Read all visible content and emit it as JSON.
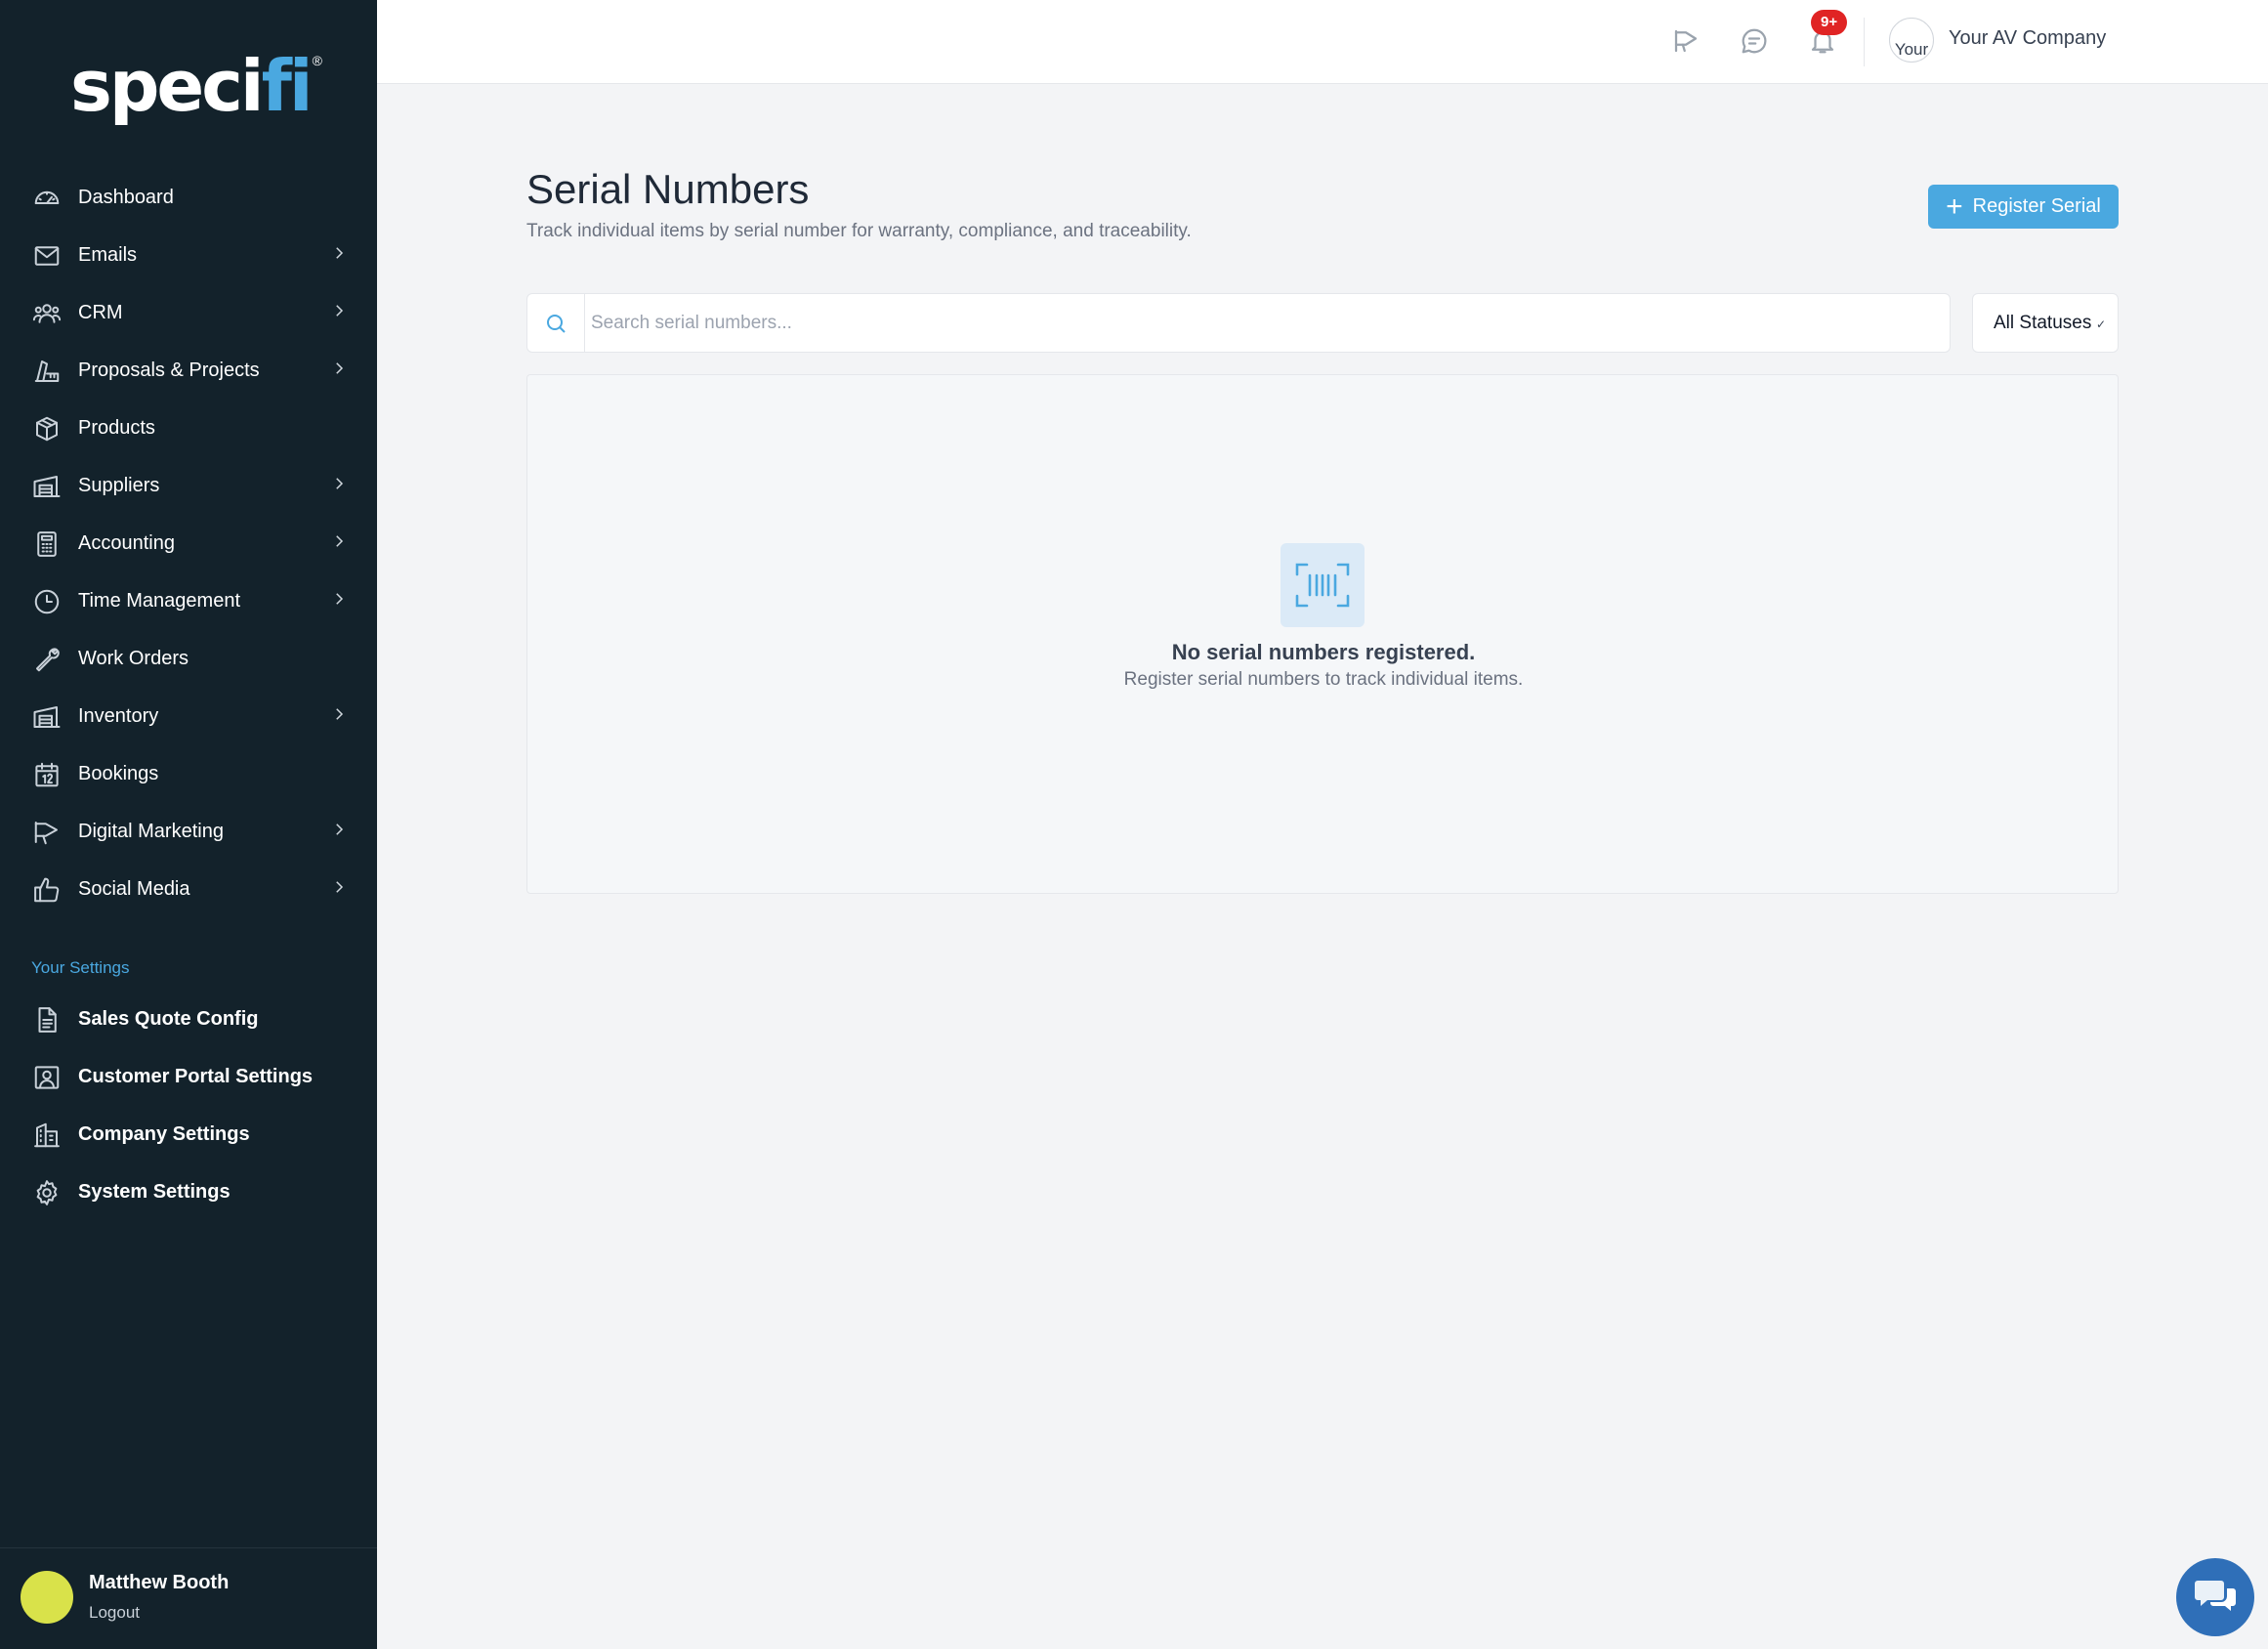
{
  "brand": {
    "logo_main": "speci",
    "logo_accent": "fi",
    "logo_reg": "®"
  },
  "sidebar": {
    "items": [
      {
        "label": "Dashboard",
        "icon": "dashboard-gauge-icon",
        "has_children": false
      },
      {
        "label": "Emails",
        "icon": "envelope-icon",
        "has_children": true
      },
      {
        "label": "CRM",
        "icon": "users-icon",
        "has_children": true
      },
      {
        "label": "Proposals & Projects",
        "icon": "pen-ruler-icon",
        "has_children": true
      },
      {
        "label": "Products",
        "icon": "box-icon",
        "has_children": false
      },
      {
        "label": "Suppliers",
        "icon": "warehouse-icon",
        "has_children": true
      },
      {
        "label": "Accounting",
        "icon": "calculator-icon",
        "has_children": true
      },
      {
        "label": "Time Management",
        "icon": "clock-icon",
        "has_children": true
      },
      {
        "label": "Work Orders",
        "icon": "wrench-icon",
        "has_children": false
      },
      {
        "label": "Inventory",
        "icon": "warehouse-icon",
        "has_children": true
      },
      {
        "label": "Bookings",
        "icon": "calendar-icon",
        "has_children": false
      },
      {
        "label": "Digital Marketing",
        "icon": "megaphone-icon",
        "has_children": true
      },
      {
        "label": "Social Media",
        "icon": "thumbs-up-icon",
        "has_children": true
      }
    ],
    "settings_title": "Your Settings",
    "settings_items": [
      {
        "label": "Sales Quote Config",
        "icon": "document-icon"
      },
      {
        "label": "Customer Portal Settings",
        "icon": "portrait-icon"
      },
      {
        "label": "Company Settings",
        "icon": "building-icon"
      },
      {
        "label": "System Settings",
        "icon": "gear-icon"
      }
    ],
    "user": {
      "name": "Matthew Booth",
      "logout": "Logout"
    }
  },
  "topbar": {
    "notifications_badge": "9+",
    "company_avatar_alt": "Your",
    "company_name": "Your AV Company"
  },
  "main": {
    "title": "Serial Numbers",
    "subtitle": "Track individual items by serial number for warranty, compliance, and traceability.",
    "register_button": "Register Serial",
    "search": {
      "placeholder": "Search serial numbers...",
      "value": ""
    },
    "status_filter": {
      "selected": "All Statuses"
    },
    "empty_state": {
      "title": "No serial numbers registered.",
      "text": "Register serial numbers to track individual items."
    }
  },
  "colors": {
    "sidebar_bg": "#13222b",
    "accent": "#4aa8e0",
    "badge": "#e02424",
    "chat": "#2f6fb8"
  }
}
